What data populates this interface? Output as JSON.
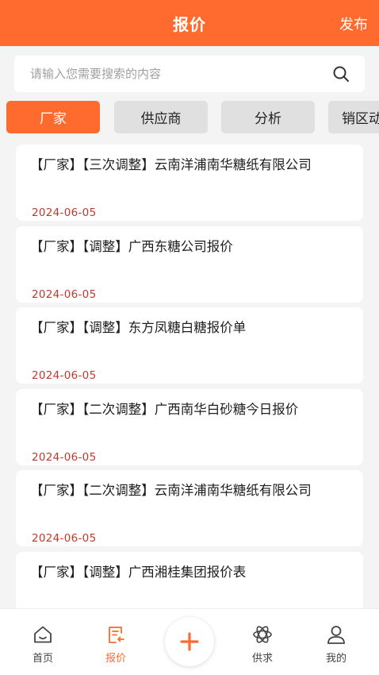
{
  "header": {
    "title": "报价",
    "publish_label": "发布"
  },
  "search": {
    "placeholder": "请输入您需要搜索的内容",
    "value": ""
  },
  "tabs": [
    {
      "label": "厂家",
      "active": true
    },
    {
      "label": "供应商",
      "active": false
    },
    {
      "label": "分析",
      "active": false
    },
    {
      "label": "销区动",
      "active": false
    }
  ],
  "items": [
    {
      "title": "【厂家】【三次调整】云南洋浦南华糖纸有限公司",
      "date": "2024-06-05"
    },
    {
      "title": "【厂家】【调整】广西东糖公司报价",
      "date": "2024-06-05"
    },
    {
      "title": "【厂家】【调整】东方凤糖白糖报价单",
      "date": "2024-06-05"
    },
    {
      "title": "【厂家】【二次调整】广西南华白砂糖今日报价",
      "date": "2024-06-05"
    },
    {
      "title": "【厂家】【二次调整】云南洋浦南华糖纸有限公司",
      "date": "2024-06-05"
    },
    {
      "title": "【厂家】【调整】广西湘桂集团报价表",
      "date": ""
    }
  ],
  "tabbar": {
    "home": "首页",
    "quote": "报价",
    "supply": "供求",
    "mine": "我的"
  },
  "colors": {
    "accent": "#ff6a2f",
    "date": "#c0392b"
  }
}
